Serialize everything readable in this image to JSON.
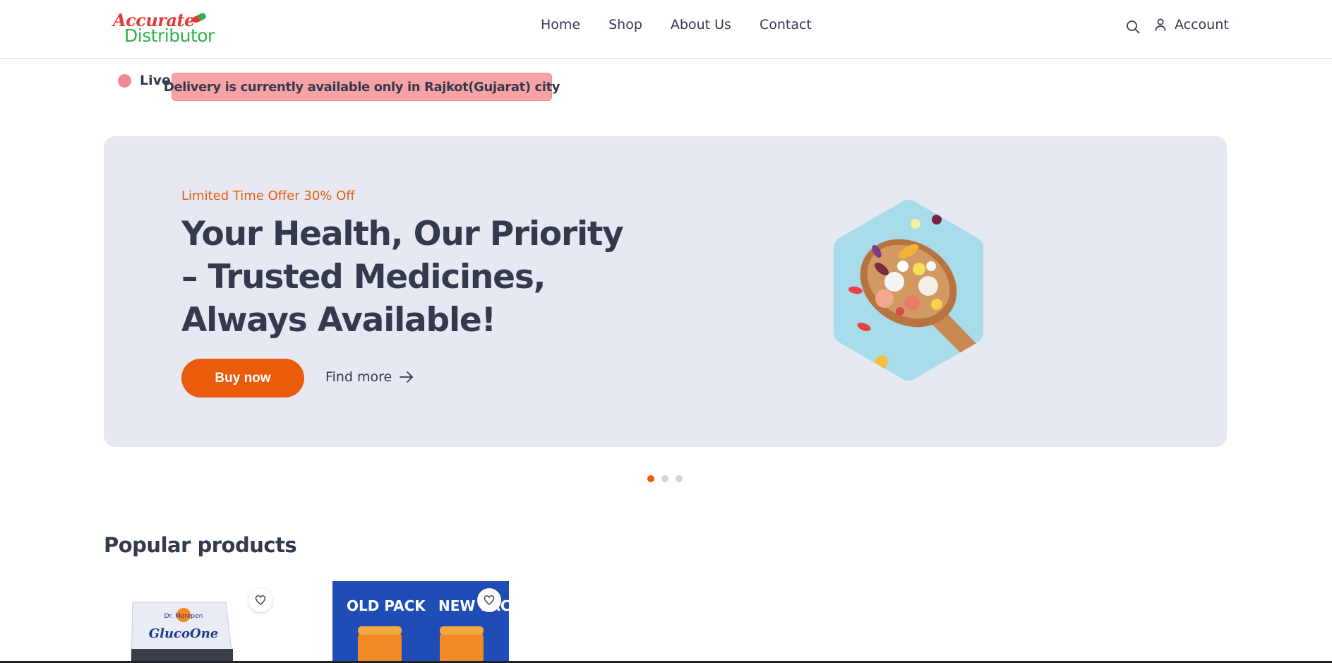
{
  "logo": {
    "line1": "Accurate",
    "line2": "Distributor"
  },
  "nav": {
    "items": [
      "Home",
      "Shop",
      "About Us",
      "Contact"
    ]
  },
  "header": {
    "account_label": "Account",
    "icons": [
      "search-icon",
      "user-icon"
    ]
  },
  "live": {
    "label": "Live",
    "notice": "Delivery is currently available only in Rajkot(Gujarat) city",
    "dot_color": "#ef8a8f"
  },
  "hero": {
    "offer": "Limited Time Offer 30% Off",
    "headline": "Your Health, Our Priority – Trusted Medicines, Always Available!",
    "buy_label": "Buy now",
    "find_label": "Find more",
    "accent": "#ea5b0c",
    "slides": 3,
    "active_slide": 1
  },
  "popular": {
    "title": "Popular products",
    "products": [
      {
        "brand_text": "Dr. Morepen",
        "name_text": "GlucoOne"
      },
      {
        "label_left": "OLD PACK",
        "label_right": "NEW PACK"
      }
    ]
  }
}
